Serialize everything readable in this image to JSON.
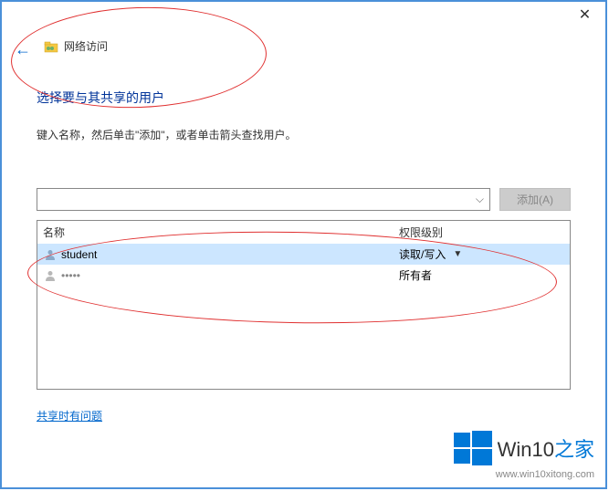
{
  "window": {
    "close": "✕"
  },
  "header": {
    "icon_name": "network-folder-icon",
    "label": "网络访问"
  },
  "main": {
    "title": "选择要与其共享的用户",
    "subtitle": "键入名称，然后单击\"添加\"，或者单击箭头查找用户。"
  },
  "input": {
    "value": "",
    "add_button": "添加(A)"
  },
  "table": {
    "cols": {
      "name": "名称",
      "perm": "权限级别"
    },
    "rows": [
      {
        "icon": "user-icon",
        "name": "student",
        "perm": "读取/写入",
        "has_dropdown": true,
        "selected": true
      },
      {
        "icon": "user-icon",
        "name": "•••••",
        "perm": "所有者",
        "has_dropdown": false,
        "selected": false
      }
    ]
  },
  "help_link": "共享时有问题",
  "watermark": {
    "brand_a": "Win10",
    "brand_b": "之家",
    "url": "www.win10xitong.com"
  }
}
